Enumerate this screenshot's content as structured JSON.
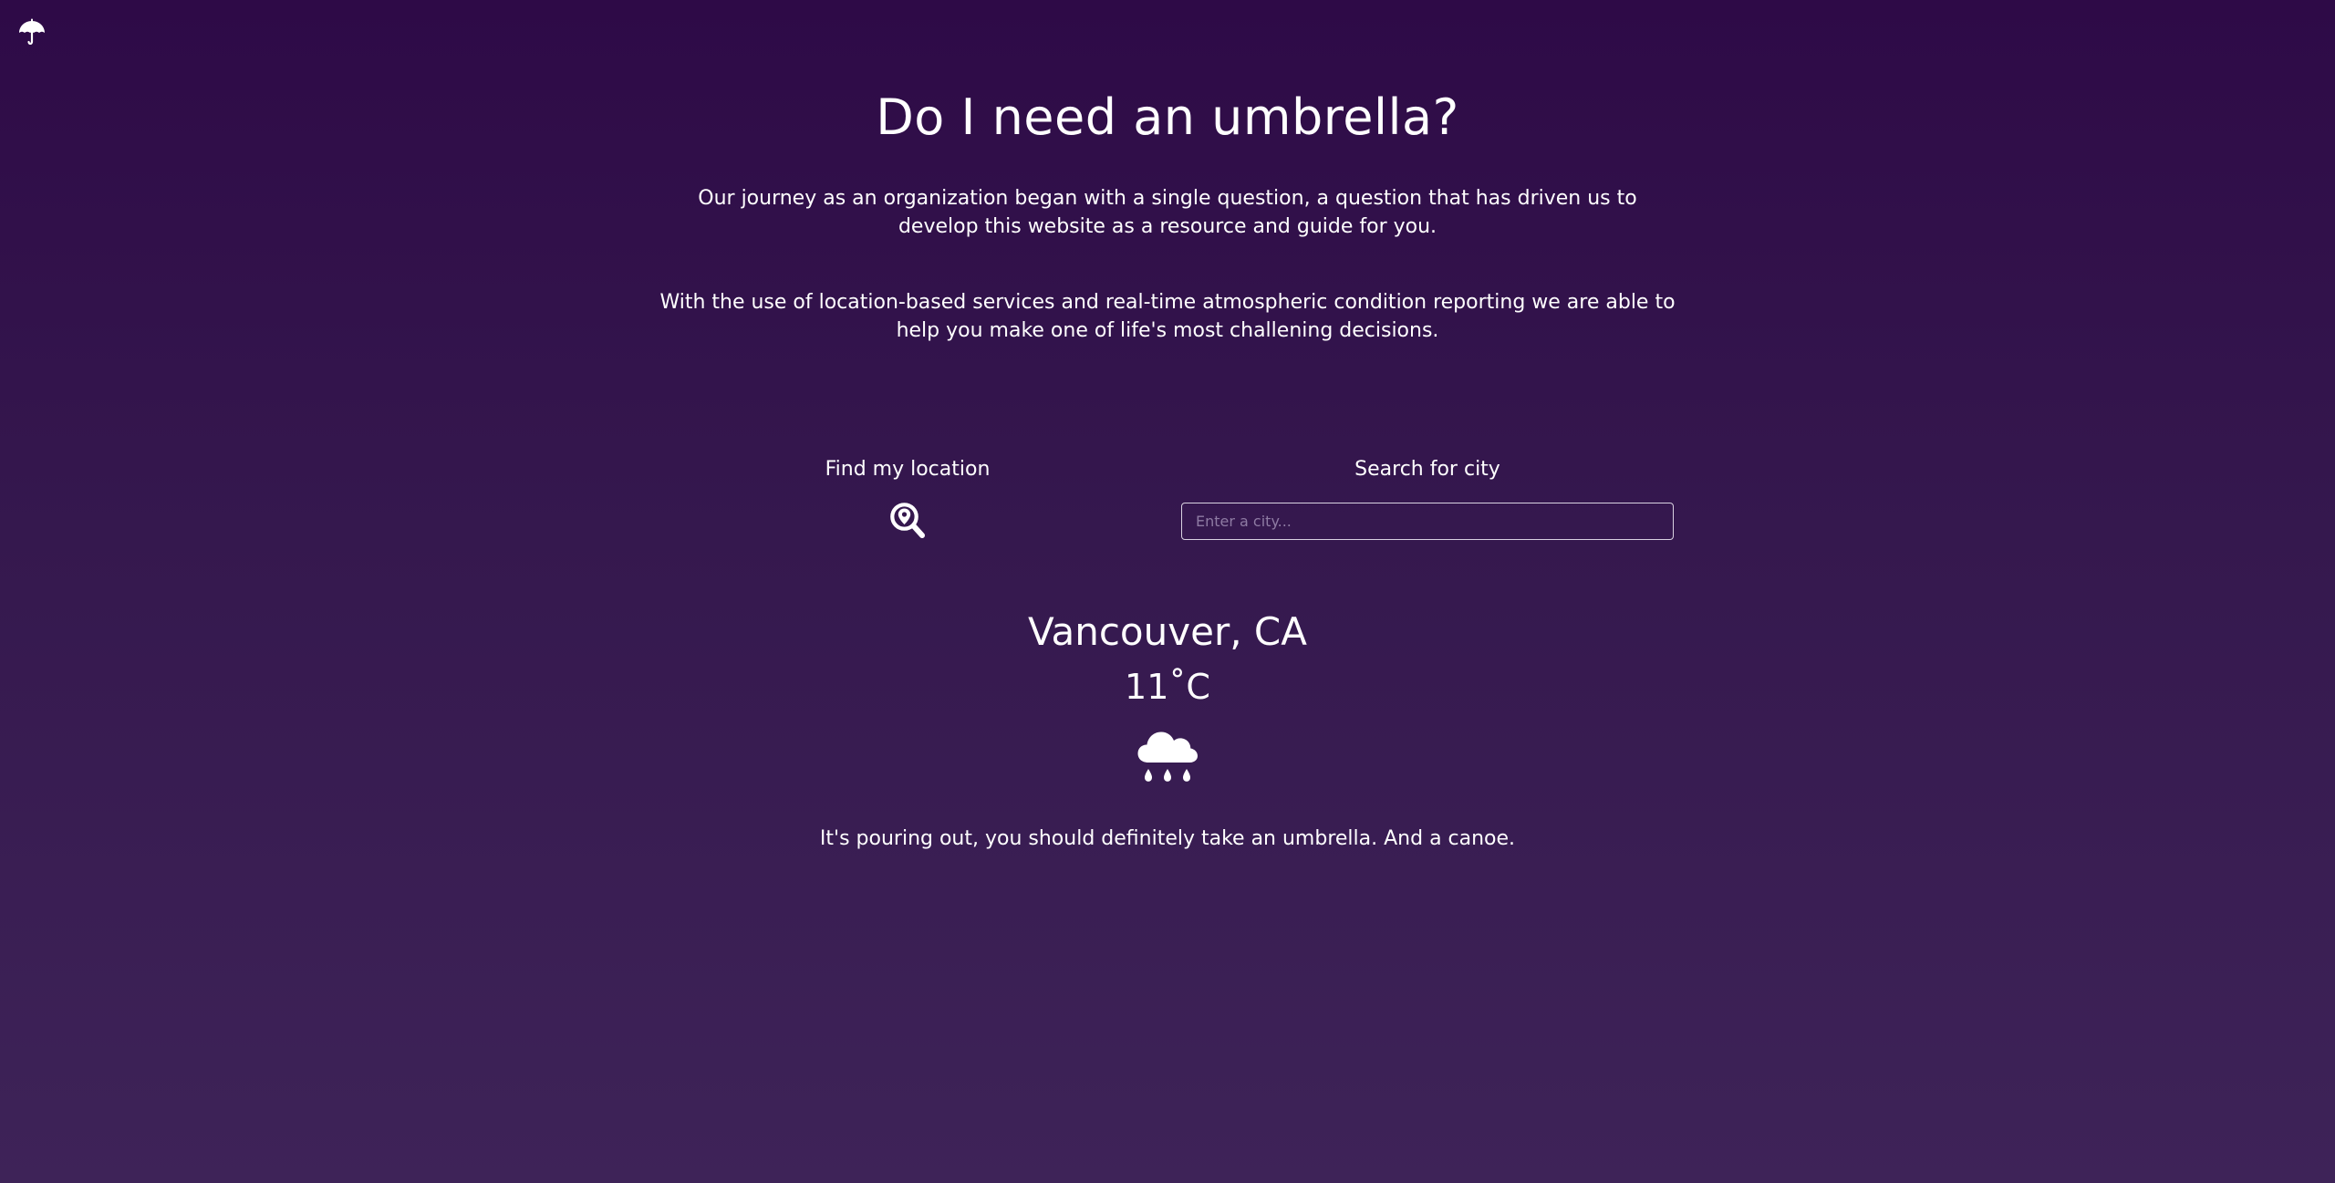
{
  "logo": {
    "icon": "umbrella-icon"
  },
  "hero": {
    "title": "Do I need an umbrella?",
    "paragraphs": [
      "Our journey as an organization began with a single question, a question that has driven us to develop this website as a resource and guide for you.",
      "With the use of location-based services and real-time atmospheric condition reporting we are able to help you make one of life's most challening decisions."
    ]
  },
  "search": {
    "find_location_label": "Find my location",
    "find_location_icon": "location-search-icon",
    "search_city_label": "Search for city",
    "city_input_value": "",
    "city_input_placeholder": "Enter a city..."
  },
  "weather": {
    "location": "Vancouver, CA",
    "temperature": "11˚C",
    "condition_icon": "rain-cloud-icon",
    "verdict": "It's pouring out, you should definitely take an umbrella. And a canoe."
  },
  "colors": {
    "background_top": "#2e0a47",
    "background_bottom": "#3e2358",
    "text": "#ffffff",
    "input_border": "#d9d2e1",
    "placeholder": "#8e7ba3"
  }
}
